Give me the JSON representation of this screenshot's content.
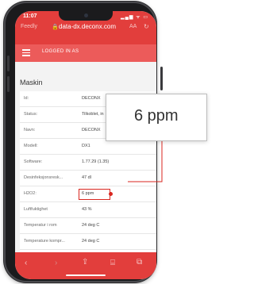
{
  "status": {
    "time": "11:07",
    "icons": "▂▄▆ ᯤ ▭"
  },
  "browser": {
    "left_label": "Feedly",
    "lock": "🔒",
    "url": "data-dx.deconx.com",
    "aa": "AA",
    "reload": "↻"
  },
  "app": {
    "logged_in": "LOGGED IN AS"
  },
  "section": {
    "title": "Maskin"
  },
  "rows": [
    {
      "label": "Id:",
      "value": "DECONX"
    },
    {
      "label": "Status:",
      "value": "Tilkoblet, in"
    },
    {
      "label": "Navn:",
      "value": "DECONX"
    },
    {
      "label": "Modell:",
      "value": "DX1"
    },
    {
      "label": "Software:",
      "value": "1.77.29 (1.35)"
    },
    {
      "label": "Desinfeksjonsresk...",
      "value": "47 dl"
    },
    {
      "label": "H2O2:",
      "value": "6 ppm"
    },
    {
      "label": "Luftfuktighet",
      "value": "43 %"
    },
    {
      "label": "Temperatur i rom",
      "value": "24 deg C"
    },
    {
      "label": "Temperature kompr...",
      "value": "24 deg C"
    }
  ],
  "callout": {
    "value": "6 ppm"
  },
  "toolbar": {
    "back": "‹",
    "forward": "›",
    "share": "⇪",
    "bookmarks": "⌸",
    "tabs": "⧉"
  },
  "colors": {
    "accent": "#e23e3c",
    "appbar": "#ec5b5a",
    "highlight": "#d9261f"
  }
}
